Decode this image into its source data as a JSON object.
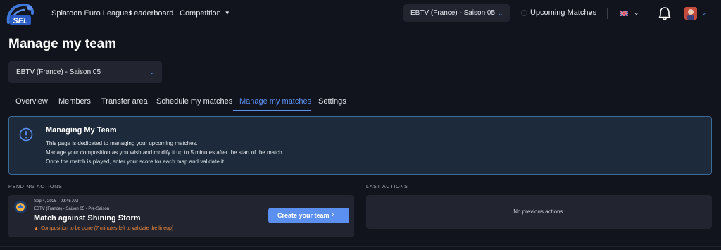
{
  "nav": {
    "logo_text": "SEL",
    "links": [
      "Splatoon Euro Leagues",
      "Leaderboard",
      "Competition"
    ],
    "season_selector": "EBTV (France) - Saison 05",
    "upcoming_matches": "Upcoming Matches"
  },
  "page": {
    "title": "Manage my team",
    "season_selector": "EBTV (France) - Saison 05"
  },
  "tabs": [
    "Overview",
    "Members",
    "Transfer area",
    "Schedule my matches",
    "Manage my matches",
    "Settings"
  ],
  "active_tab": "Manage my matches",
  "info": {
    "title": "Managing My Team",
    "lines": [
      "This page is dedicated to managing your upcoming matches.",
      "Manage your composition as you wish and modify it up to 5 minutes after the start of the match.",
      "Once the match is played, enter your score for each map and validate it."
    ]
  },
  "pending": {
    "label": "PENDING ACTIONS",
    "date": "Sep 4, 2025 - 09:45 AM",
    "competition": "EBTV (France) - Saison 05 - Pré-Saison",
    "title": "Match against Shining Storm",
    "warning": "Composition to be done (7 minutes left to validate the lineup)",
    "button": "Create your team"
  },
  "last": {
    "label": "LAST ACTIONS",
    "empty": "No previous actions."
  },
  "colors": {
    "background": "#11141c",
    "accent": "#5b8ff0",
    "info_bg": "#1c2a3b",
    "info_border": "#3a6a96",
    "warning": "#f0883e",
    "card": "#22252f"
  },
  "icons": {
    "logo": "sel-logo-icon",
    "bell": "bell-icon",
    "flag": "uk-flag-icon",
    "info": "exclamation-circle-icon",
    "warning": "fire-icon",
    "arrow": "chevron-right-icon"
  }
}
